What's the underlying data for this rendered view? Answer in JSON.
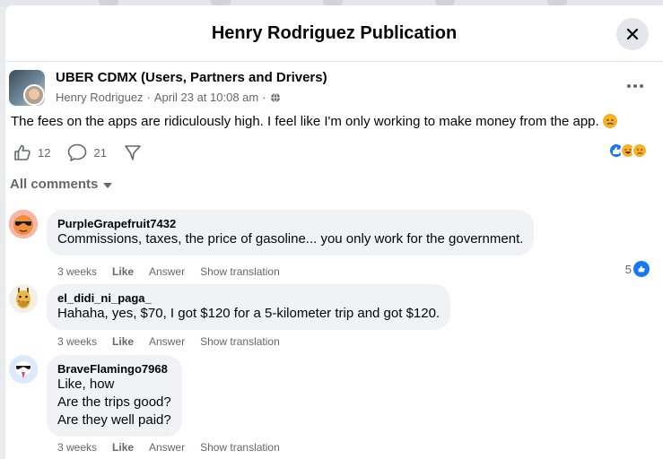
{
  "modal": {
    "title": "Henry Rodriguez Publication"
  },
  "post": {
    "group_name": "UBER CDMX (Users, Partners and Drivers)",
    "author": "Henry Rodriguez",
    "date": "April 23 at 10:08 am",
    "separator": "·",
    "text": "The fees on the apps are ridiculously high. I feel like I'm only working to make money from the app.",
    "like_count": "12",
    "comment_count": "21"
  },
  "comments_header": {
    "label": "All comments"
  },
  "comments": [
    {
      "author": "PurpleGrapefruit7432",
      "lines": [
        "Commissions, taxes, the price of gasoline... you only work for the government."
      ],
      "time": "3 weeks",
      "like": "Like",
      "answer": "Answer",
      "translate": "Show translation",
      "reactions": "5"
    },
    {
      "author": "el_didi_ni_paga_",
      "lines": [
        "Hahaha, yes, $70, I got $120 for a 5-kilometer trip and got $120."
      ],
      "time": "3 weeks",
      "like": "Like",
      "answer": "Answer",
      "translate": "Show translation"
    },
    {
      "author": "BraveFlamingo7968",
      "lines": [
        "Like, how",
        "Are the trips good?",
        "Are they well paid?"
      ],
      "time": "3 weeks",
      "like": "Like",
      "answer": "Answer",
      "translate": "Show translation"
    }
  ],
  "colors": {
    "like_blue": "#1877f2",
    "haha_yellow": "#f7b125",
    "secondary_text": "#65676b",
    "bubble_bg": "#f0f2f5"
  },
  "icons": {
    "close": "close-icon",
    "more": "more-options-icon",
    "like": "thumbs-up-icon",
    "comment": "comment-bubble-icon",
    "share": "share-icon",
    "globe": "globe-icon",
    "caret": "caret-down-icon"
  }
}
